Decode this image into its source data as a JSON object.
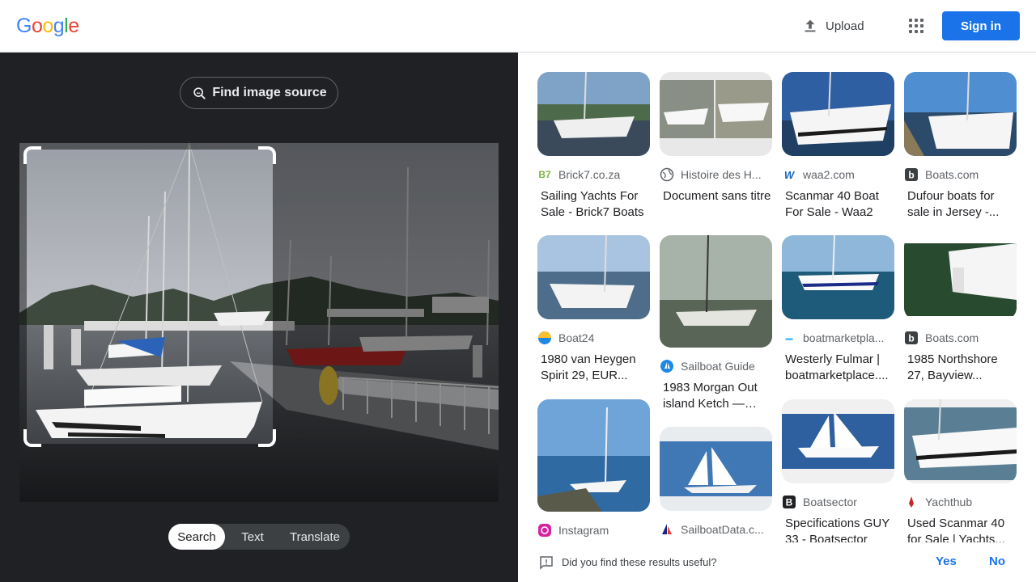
{
  "header": {
    "logo_letters": [
      "G",
      "o",
      "o",
      "g",
      "l",
      "e"
    ],
    "logo_colors": [
      "#4285F4",
      "#EA4335",
      "#FBBC05",
      "#4285F4",
      "#34A853",
      "#EA4335"
    ],
    "upload_label": "Upload",
    "signin_label": "Sign in",
    "accent": "#1a73e8"
  },
  "left": {
    "find_source_label": "Find image source",
    "tabs": [
      {
        "label": "Search",
        "active": true
      },
      {
        "label": "Text",
        "active": false
      },
      {
        "label": "Translate",
        "active": false
      }
    ]
  },
  "results": [
    {
      "source": "Brick7.co.za",
      "favicon": "B7",
      "title": "Sailing Yachts For Sale - Brick7 Boats",
      "icon": "brick7-favicon"
    },
    {
      "source": "Histoire des H...",
      "favicon": "globe",
      "title": "Document sans titre",
      "icon": "globe-icon"
    },
    {
      "source": "waa2.com",
      "favicon": "W",
      "title": "Scanmar 40 Boat For Sale - Waa2",
      "icon": "waa2-favicon"
    },
    {
      "source": "Boats.com",
      "favicon": "b",
      "title": "Dufour boats for sale in Jersey -...",
      "icon": "boats-com-favicon"
    },
    {
      "source": "Boat24",
      "favicon": "circle",
      "title": "1980 van Heygen Spirit 29, EUR...",
      "icon": "boat24-favicon"
    },
    {
      "source": "Sailboat Guide",
      "favicon": "sg",
      "title": "1983 Morgan Out island Ketch — Fo...",
      "icon": "sailboat-guide-favicon"
    },
    {
      "source": "boatmarketpla...",
      "favicon": "bm",
      "title": "Westerly Fulmar | boatmarketplace....",
      "icon": "boatmarketplace-favicon"
    },
    {
      "source": "Boats.com",
      "favicon": "b",
      "title": "1985 Northshore 27, Bayview...",
      "icon": "boats-com-favicon"
    },
    {
      "source": "Instagram",
      "favicon": "ig",
      "title": "",
      "icon": "instagram-icon"
    },
    {
      "source": "SailboatData.c...",
      "favicon": "sd",
      "title": "",
      "icon": "sailboatdata-favicon"
    },
    {
      "source": "Boatsector",
      "favicon": "B",
      "title": "Specifications GUY 33 - Boatsector",
      "icon": "boatsector-favicon"
    },
    {
      "source": "Yachthub",
      "favicon": "yh",
      "title": "Used Scanmar 40 for Sale | Yachts...",
      "icon": "yachthub-favicon"
    }
  ],
  "feedback": {
    "question": "Did you find these results useful?",
    "yes": "Yes",
    "no": "No"
  }
}
